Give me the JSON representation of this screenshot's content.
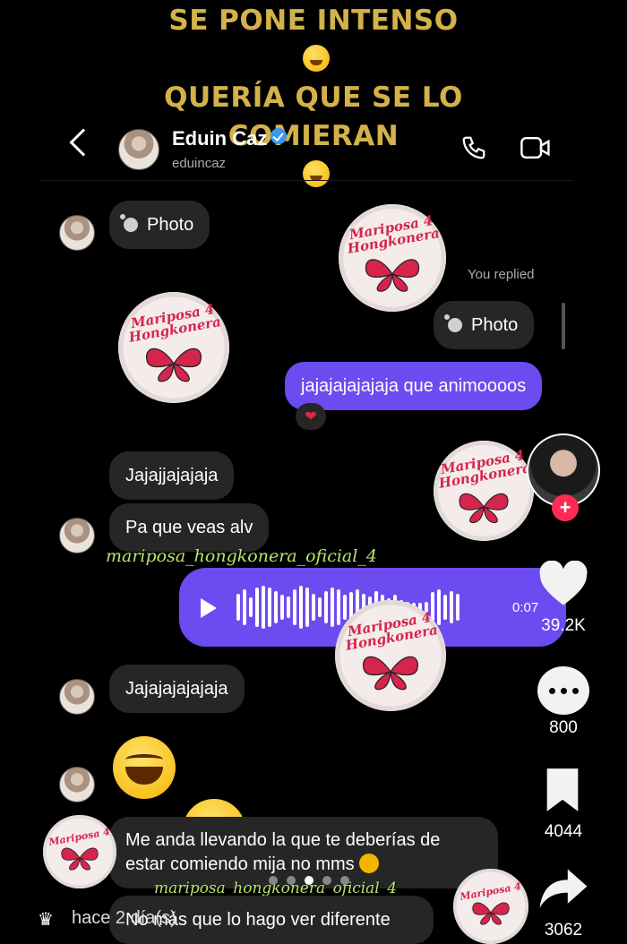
{
  "caption": {
    "line1": "SE PONE INTENSO",
    "line2": "QUERÍA QUE SE LO",
    "line3": "COMIERAN"
  },
  "header": {
    "name": "Eduin Caz",
    "username": "eduincaz"
  },
  "messages": {
    "photo_label": "Photo",
    "you_replied": "You replied",
    "reply_photo_label": "Photo",
    "out_text": "jajajajajajaja que animoooos",
    "reaction": "❤",
    "in1": "Jajajjajajaja",
    "in2": "Pa que veas alv",
    "voice_duration": "0:07",
    "in3": "Jajajajajajaja",
    "in4_line1": "Me anda llevando la que te deberías de",
    "in4_line2": "estar comiendo mija no mms",
    "in5": "No más que lo hago ver diferente"
  },
  "watermark": {
    "line1": "Mariposa",
    "line2": "Hongkonera",
    "number": "4"
  },
  "overlay": {
    "username1": "mariposa_hongkonera_oficial_4",
    "username2": "mariposa_hongkonera_oficial_4",
    "time_ago": "hace 2 día(s)"
  },
  "side": {
    "likes": "39.2K",
    "comments": "800",
    "saves": "4044",
    "shares": "3062"
  },
  "icons": {
    "laugh_emoji": "face-with-tears-of-joy",
    "angry_emoji": "persevering-face",
    "verified": "verified-badge"
  },
  "colors": {
    "caption": "#d4b24a",
    "outgoing_bubble": "#6c4bf0",
    "incoming_bubble": "#262626",
    "username_overlay": "#b9e56b",
    "follow_plus": "#fe2c55"
  }
}
